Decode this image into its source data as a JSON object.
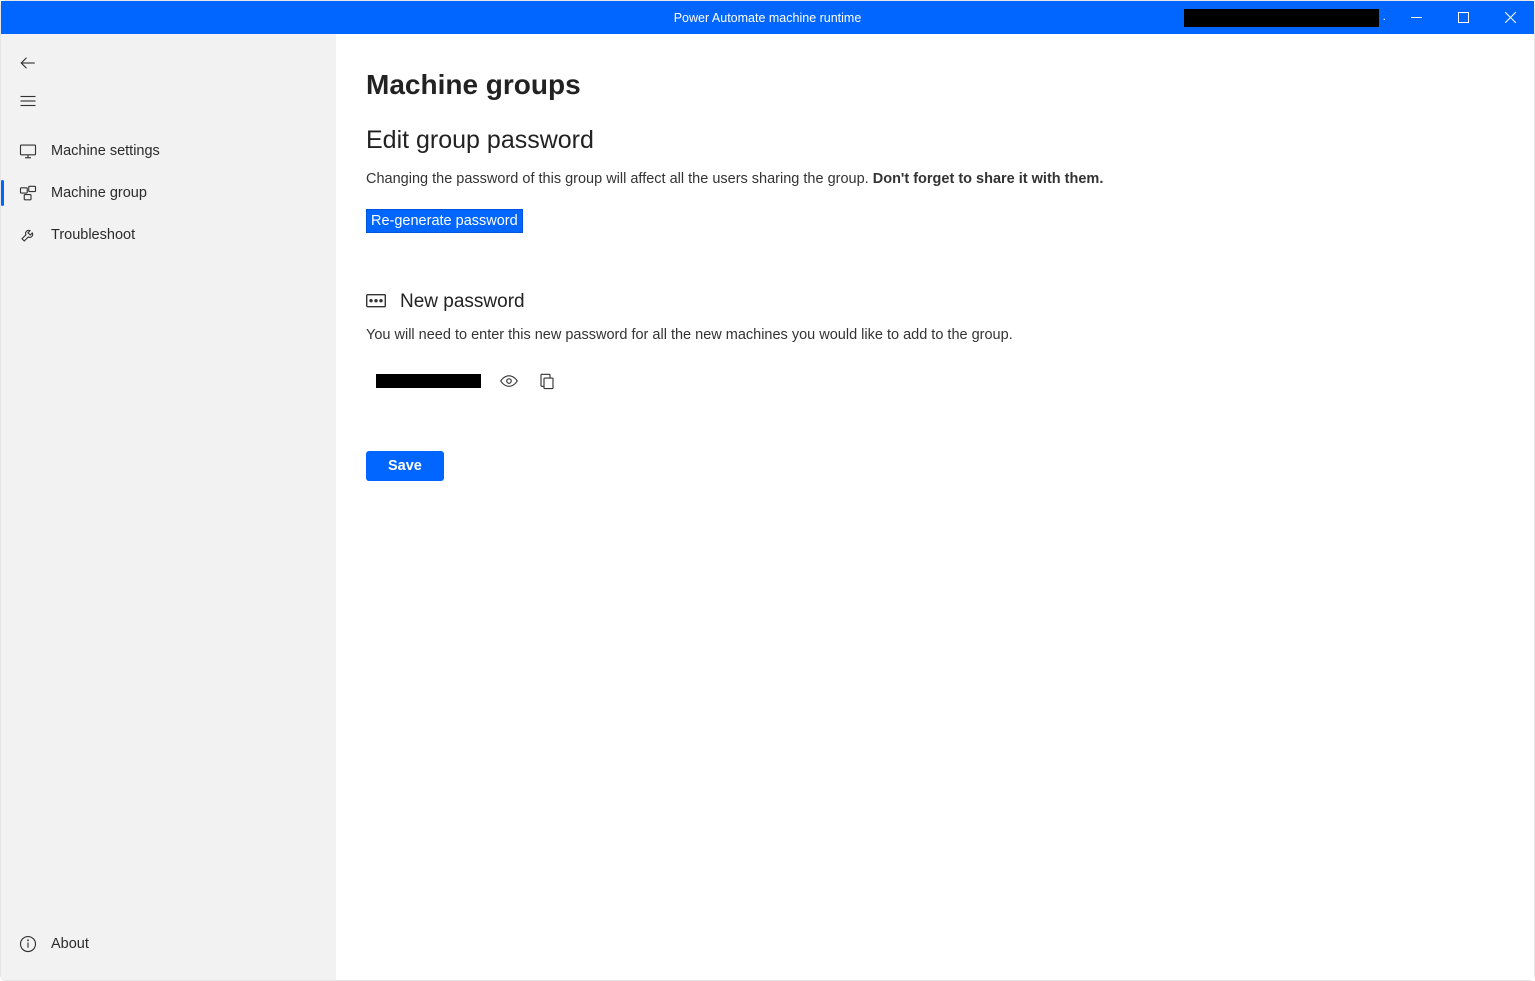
{
  "titlebar": {
    "title": "Power Automate machine runtime"
  },
  "sidebar": {
    "items": [
      {
        "label": "Machine settings"
      },
      {
        "label": "Machine group"
      },
      {
        "label": "Troubleshoot"
      }
    ],
    "footer": {
      "about_label": "About"
    }
  },
  "main": {
    "page_title": "Machine groups",
    "section_title": "Edit group password",
    "description_text": "Changing the password of this group will affect all the users sharing the group. ",
    "description_strong": "Don't forget to share it with them.",
    "regen_label": "Re-generate password",
    "subsection_title": "New password",
    "subsection_description": "You will need to enter this new password for all the new machines you would like to add to the group.",
    "save_label": "Save"
  }
}
